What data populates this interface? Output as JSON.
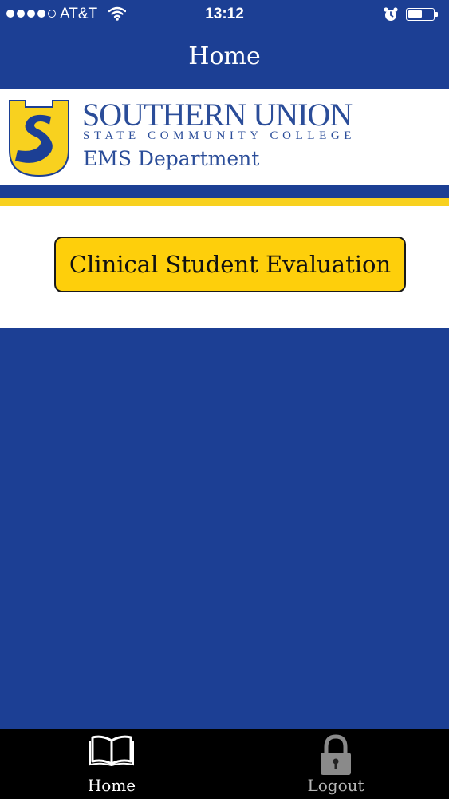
{
  "status_bar": {
    "carrier": "AT&T",
    "time": "13:12",
    "signal_bars_filled": 4,
    "signal_bars_total": 5,
    "icons": [
      "signal-dots-icon",
      "wifi-icon",
      "alarm-clock-icon",
      "battery-icon"
    ]
  },
  "nav": {
    "title": "Home"
  },
  "banner": {
    "college_name": "SOUTHERN UNION",
    "college_subtitle": "STATE COMMUNITY COLLEGE",
    "department": "EMS Department",
    "logo_icon": "southern-union-s-logo-icon"
  },
  "content": {
    "evaluation_button": "Clinical Student Evaluation"
  },
  "tab_bar": {
    "tabs": [
      {
        "label": "Home",
        "icon": "open-book-icon",
        "selected": true
      },
      {
        "label": "Logout",
        "icon": "padlock-icon",
        "selected": false
      }
    ]
  },
  "colors": {
    "brand_blue": "#1c3f94",
    "brand_yellow": "#f8d11f",
    "button_yellow": "#fecf0b",
    "text_blue": "#2b4d99",
    "tab_bar_background": "#000000"
  }
}
